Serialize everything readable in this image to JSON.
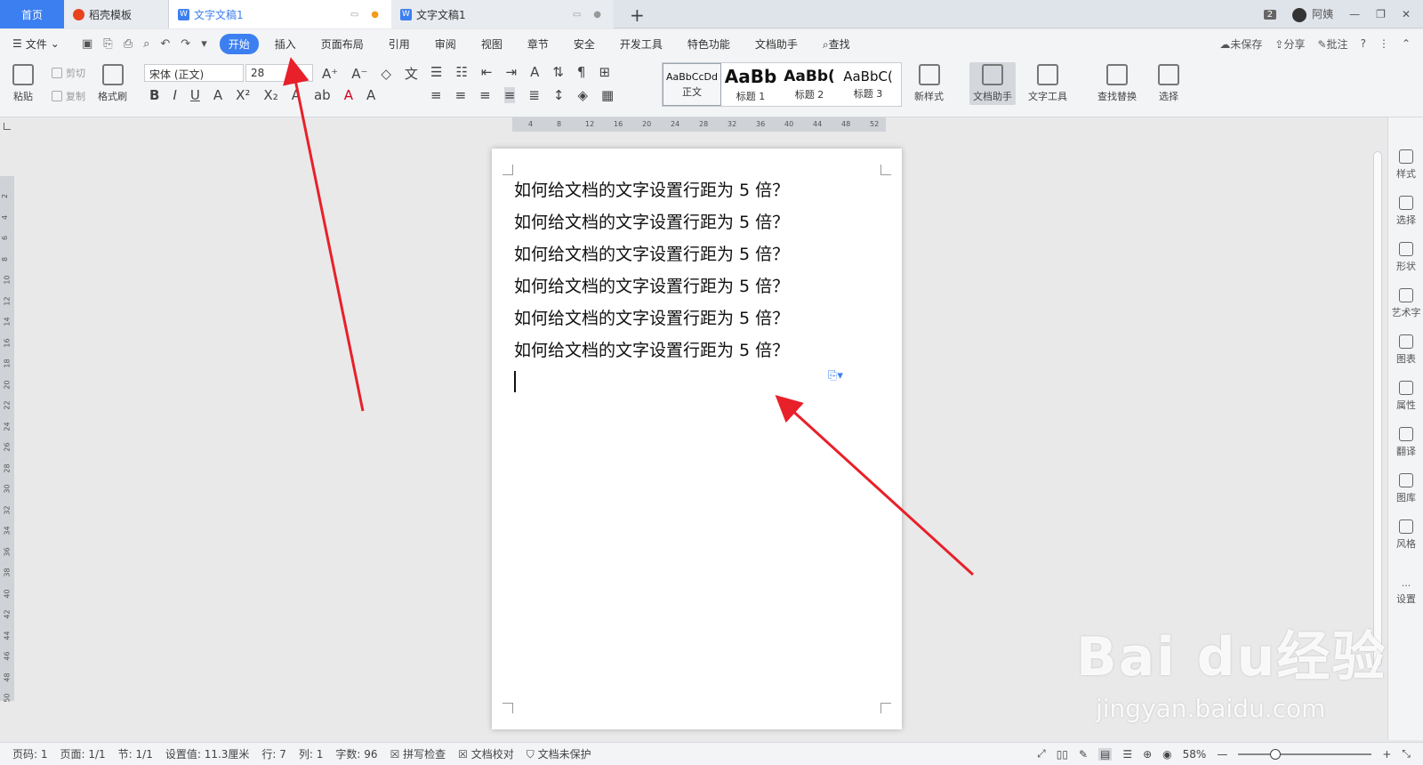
{
  "tabs": {
    "home": "首页",
    "template": "稻壳模板",
    "doc1": "文字文稿1",
    "doc2": "文字文稿1",
    "new_tab": "+"
  },
  "window": {
    "count": "2",
    "user": "阿姨"
  },
  "menu": {
    "file": "文件",
    "tabs": [
      "开始",
      "插入",
      "页面布局",
      "引用",
      "审阅",
      "视图",
      "章节",
      "安全",
      "开发工具",
      "特色功能",
      "文档助手"
    ],
    "search": "查找",
    "unsaved": "未保存",
    "share": "分享",
    "comment": "批注"
  },
  "ribbon": {
    "paste": "粘贴",
    "cut": "剪切",
    "copy": "复制",
    "format_painter": "格式刷",
    "font_name": "宋体 (正文)",
    "font_size": "28",
    "styles": [
      {
        "preview": "AaBbCcDd",
        "name": "正文"
      },
      {
        "preview": "AaBb",
        "name": "标题 1"
      },
      {
        "preview": "AaBb(",
        "name": "标题 2"
      },
      {
        "preview": "AaBbC(",
        "name": "标题 3"
      }
    ],
    "new_style": "新样式",
    "doc_assistant": "文档助手",
    "text_tools": "文字工具",
    "find_replace": "查找替换",
    "select": "选择"
  },
  "ruler": {
    "h_ticks": [
      "4",
      "8",
      "12",
      "16",
      "20",
      "24",
      "28",
      "32",
      "36",
      "40",
      "44",
      "48",
      "52"
    ],
    "v_ticks": [
      "2",
      "4",
      "6",
      "8",
      "10",
      "12",
      "14",
      "16",
      "18",
      "20",
      "22",
      "24",
      "26",
      "28",
      "30",
      "32",
      "34",
      "36",
      "38",
      "40",
      "42",
      "44",
      "46",
      "48",
      "50"
    ]
  },
  "document": {
    "lines": [
      "如何给文档的文字设置行距为 5 倍？",
      "如何给文档的文字设置行距为 5 倍？",
      "如何给文档的文字设置行距为 5 倍？",
      "如何给文档的文字设置行距为 5 倍？",
      "如何给文档的文字设置行距为 5 倍？",
      "如何给文档的文字设置行距为 5 倍？"
    ]
  },
  "sidebar": [
    "样式",
    "选择",
    "形状",
    "艺术字",
    "图表",
    "属性",
    "翻译",
    "图库",
    "风格",
    "设置"
  ],
  "status": {
    "page_no": "页码: 1",
    "pages": "页面: 1/1",
    "section": "节: 1/1",
    "position": "设置值: 11.3厘米",
    "row": "行: 7",
    "col": "列: 1",
    "word_count": "字数: 96",
    "spell_check": "拼写检查",
    "doc_check": "文档校对",
    "protect": "文档未保护",
    "zoom": "58%"
  },
  "watermark": {
    "main": "Bai du经验",
    "sub": "jingyan.baidu.com"
  },
  "colors": {
    "accent": "#3c7ff0",
    "arrow": "#e8202a"
  }
}
